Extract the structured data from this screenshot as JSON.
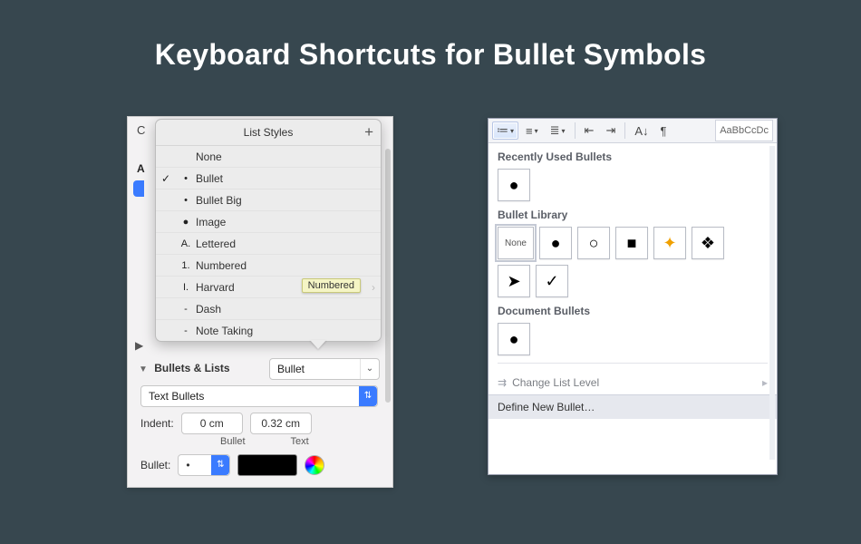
{
  "page": {
    "title": "Keyboard Shortcuts for Bullet Symbols"
  },
  "mac": {
    "edge_c": "C",
    "edge_a": "A",
    "popover_title": "List Styles",
    "items": [
      {
        "checked": false,
        "icon": "",
        "label": "None"
      },
      {
        "checked": true,
        "icon": "•",
        "label": "Bullet"
      },
      {
        "checked": false,
        "icon": "•",
        "label": "Bullet Big"
      },
      {
        "checked": false,
        "icon": "●",
        "label": "Image"
      },
      {
        "checked": false,
        "icon": "A.",
        "label": "Lettered"
      },
      {
        "checked": false,
        "icon": "1.",
        "label": "Numbered"
      },
      {
        "checked": false,
        "icon": "I.",
        "label": "Harvard",
        "tooltip": "Numbered",
        "chevron": true
      },
      {
        "checked": false,
        "icon": "-",
        "label": "Dash"
      },
      {
        "checked": false,
        "icon": "-",
        "label": "Note Taking"
      }
    ],
    "section": "Bullets & Lists",
    "dropdown_style": "Bullet",
    "dropdown_kind": "Text Bullets",
    "indent_label": "Indent:",
    "indent_bullet": "0 cm",
    "indent_text": "0.32 cm",
    "sub_bullet": "Bullet",
    "sub_text": "Text",
    "bullet_label": "Bullet:",
    "bullet_char": "•"
  },
  "word": {
    "styles_preview": "AaBbCcDc",
    "recent_title": "Recently Used Bullets",
    "library_title": "Bullet Library",
    "doc_title": "Document Bullets",
    "library": [
      {
        "label": "None",
        "glyph": ""
      },
      {
        "label": "disc",
        "glyph": "●"
      },
      {
        "label": "circle",
        "glyph": "○"
      },
      {
        "label": "square",
        "glyph": "■"
      },
      {
        "label": "four-star",
        "glyph": "✦"
      },
      {
        "label": "four-diamonds",
        "glyph": "❖"
      },
      {
        "label": "arrowhead",
        "glyph": "➤"
      },
      {
        "label": "checkmark",
        "glyph": "✓"
      }
    ],
    "recent_glyph": "●",
    "doc_glyph": "●",
    "change_level": "Change List Level",
    "define_new": "Define New Bullet…"
  }
}
